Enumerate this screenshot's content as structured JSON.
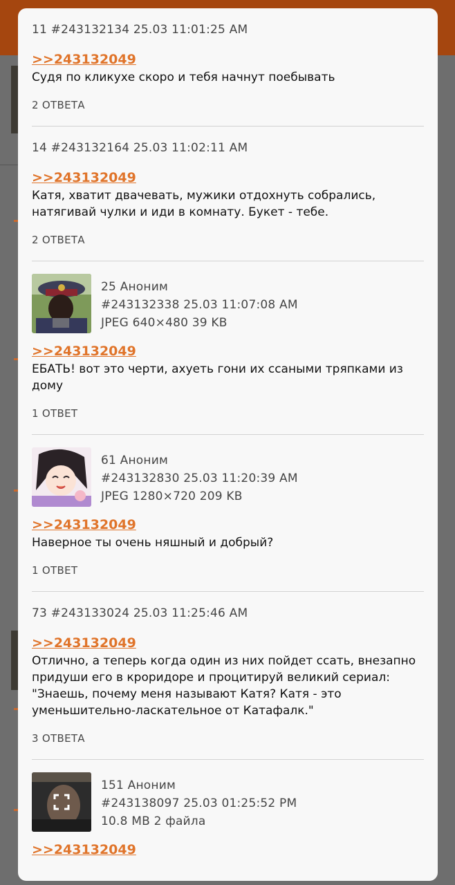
{
  "posts": [
    {
      "header": "11 #243132134 25.03 11:01:25 AM",
      "reply_link": ">>243132049",
      "text": "Судя по кликухе скоро и тебя начнут поебывать",
      "answers": "2 ОТВЕТА"
    },
    {
      "header": "14 #243132164 25.03 11:02:11 AM",
      "reply_link": ">>243132049",
      "text": "Катя, хватит двачевать, мужики отдохнуть собрались, натягивай чулки и иди в комнату. Букет - тебе.",
      "answers": "2 ОТВЕТА"
    },
    {
      "line1": "25 Аноним",
      "line2": "#243132338 25.03 11:07:08 AM",
      "line3": "JPEG 640×480 39 KB",
      "thumb_icon": "police-officer-thumbnail",
      "reply_link": ">>243132049",
      "text": "ЕБАТЬ! вот это черти, ахуеть гони их ссаными тряпками из дому",
      "answers": "1 ОТВЕТ"
    },
    {
      "line1": "61 Аноним",
      "line2": "#243132830 25.03 11:20:39 AM",
      "line3": "JPEG 1280×720 209 KB",
      "thumb_icon": "anime-girl-thumbnail",
      "reply_link": ">>243132049",
      "text": "Наверное ты очень няшный и добрый?",
      "answers": "1 ОТВЕТ"
    },
    {
      "header": "73 #243133024 25.03 11:25:46 AM",
      "reply_link": ">>243132049",
      "text": "Отлично, а теперь когда один из них пойдет ссать, внезапно придуши его в кроридоре и процитируй великий сериал: \"Знаешь, почему меня называют Катя? Катя - это уменьшительно-ласкательное от Катафалк.\"",
      "answers": "3 ОТВЕТА"
    },
    {
      "line1": "151 Аноним",
      "line2": "#243138097 25.03 01:25:52 PM",
      "line3": "10.8 MB 2 файла",
      "thumb_icon": "video-thumbnail",
      "reply_link": ">>243132049"
    }
  ],
  "colors": {
    "accent_link": "#e0742a",
    "topbar": "#a5460f",
    "modal_bg": "#f8f8f8"
  }
}
